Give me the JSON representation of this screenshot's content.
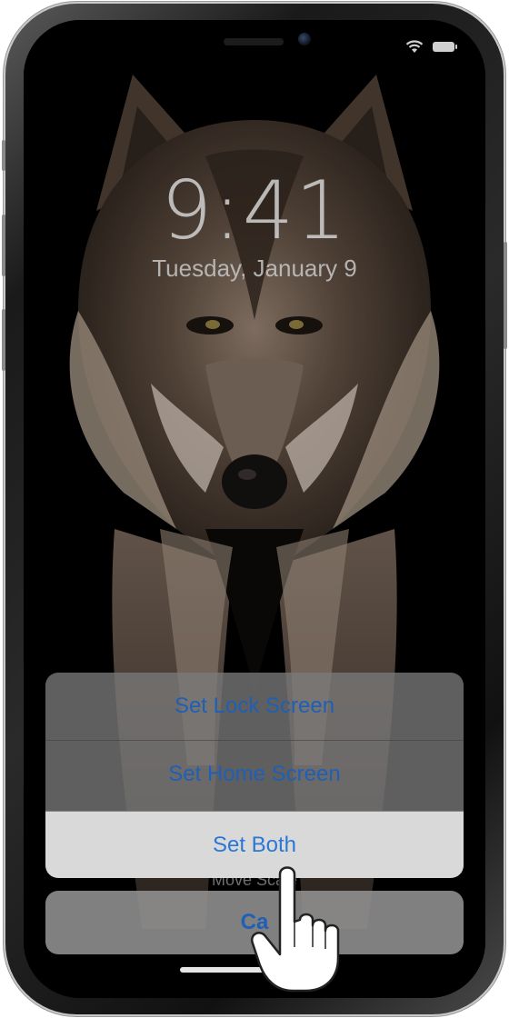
{
  "lock_screen": {
    "time": "9:41",
    "date": "Tuesday, January 9"
  },
  "status_bar": {
    "icons": [
      "wifi-icon",
      "battery-icon"
    ]
  },
  "wallpaper": {
    "subject": "wolf",
    "colors": {
      "background": "#000000",
      "fur_dark": "#3b2e25",
      "fur_light": "#c7b8a8"
    }
  },
  "action_sheet": {
    "options": [
      {
        "label": "Set Lock Screen"
      },
      {
        "label": "Set Home Screen"
      },
      {
        "label": "Set Both",
        "highlighted": true
      }
    ],
    "cancel_label": "Ca",
    "move_scale_hint": "Move   Scale"
  },
  "colors": {
    "accent": "#1f5fb5",
    "highlight_bg": "#dedede"
  }
}
